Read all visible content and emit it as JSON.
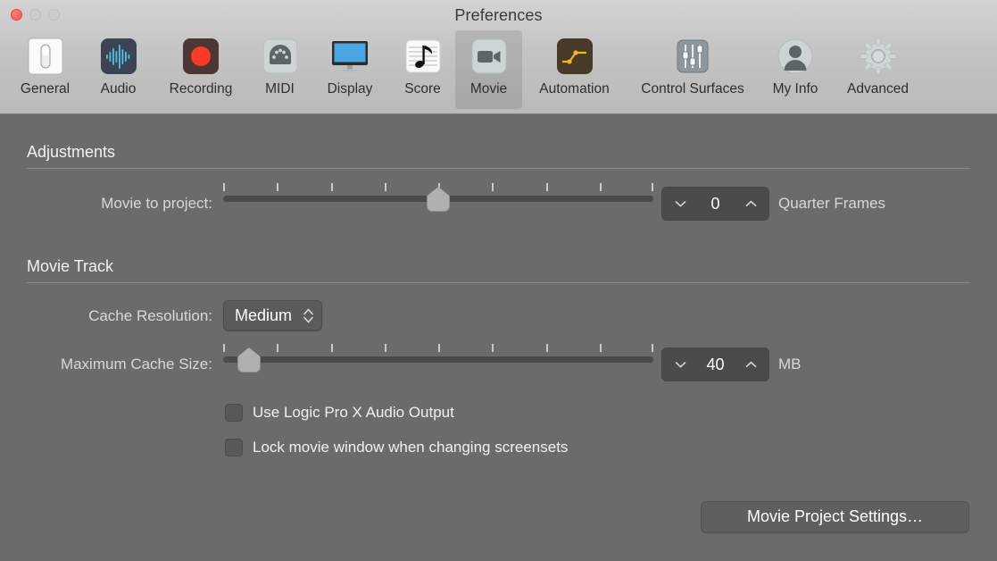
{
  "window": {
    "title": "Preferences",
    "traffic_lights": [
      "close",
      "minimize",
      "maximize"
    ]
  },
  "toolbar": {
    "selected": "Movie",
    "items": [
      {
        "label": "General",
        "icon": "toggle-switch-icon"
      },
      {
        "label": "Audio",
        "icon": "waveform-icon"
      },
      {
        "label": "Recording",
        "icon": "record-circle-icon"
      },
      {
        "label": "MIDI",
        "icon": "midi-din-connector-icon"
      },
      {
        "label": "Display",
        "icon": "monitor-icon"
      },
      {
        "label": "Score",
        "icon": "music-note-staff-icon"
      },
      {
        "label": "Movie",
        "icon": "video-camera-icon"
      },
      {
        "label": "Automation",
        "icon": "automation-curve-icon"
      },
      {
        "label": "Control Surfaces",
        "icon": "faders-icon"
      },
      {
        "label": "My Info",
        "icon": "person-avatar-icon"
      },
      {
        "label": "Advanced",
        "icon": "gear-icon"
      }
    ]
  },
  "adjustments": {
    "title": "Adjustments",
    "movie_to_project": {
      "label": "Movie to project:",
      "value": "0",
      "unit": "Quarter Frames",
      "slider": {
        "ticks": 9,
        "thumb_percent": 50
      },
      "stepper_down_icon": "chevron-down-icon",
      "stepper_up_icon": "chevron-up-icon"
    }
  },
  "movie_track": {
    "title": "Movie Track",
    "cache_resolution": {
      "label": "Cache Resolution:",
      "value": "Medium",
      "chevron_icon": "chevron-up-down-icon"
    },
    "maximum_cache_size": {
      "label": "Maximum Cache Size:",
      "value": "40",
      "unit": "MB",
      "slider": {
        "ticks": 9,
        "thumb_percent": 6
      },
      "stepper_down_icon": "chevron-down-icon",
      "stepper_up_icon": "chevron-up-icon"
    },
    "checkboxes": [
      {
        "label": "Use Logic Pro X Audio Output",
        "checked": false
      },
      {
        "label": "Lock movie window when changing screensets",
        "checked": false
      }
    ]
  },
  "footer": {
    "movie_project_settings_label": "Movie Project Settings…"
  },
  "colors": {
    "window_background": "#6b6b6b",
    "toolbar_background": "#c4c4c4",
    "close_button": "#f9584c",
    "text_primary": "#f2f2f2",
    "text_secondary": "#d8d8d8",
    "slider_track": "#4a4a4a",
    "slider_thumb": "#b0b0b0",
    "control_background": "#5b5b5b"
  }
}
